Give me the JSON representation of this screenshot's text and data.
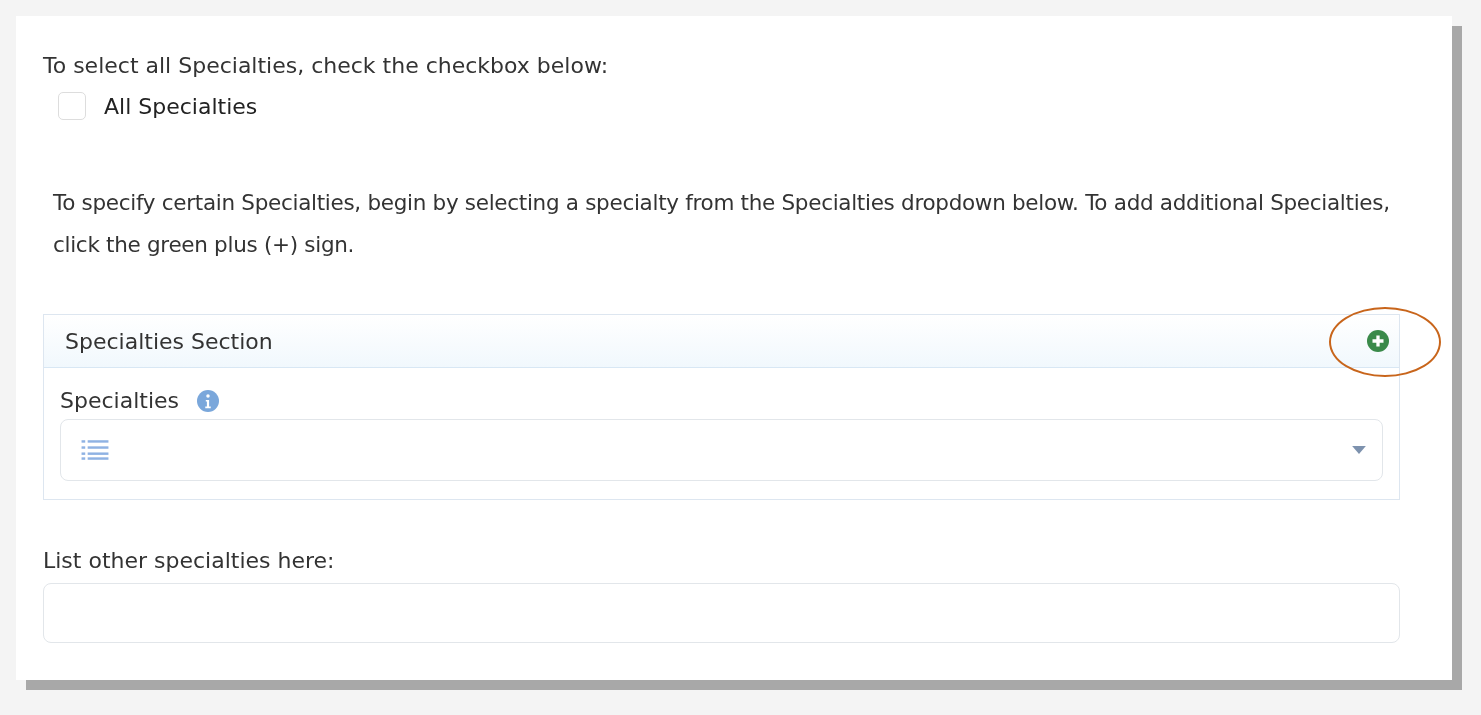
{
  "intro_text": "To select all Specialties, check the checkbox below:",
  "all_checkbox": {
    "label": "All Specialties",
    "checked": false
  },
  "instructions": "To specify certain Specialties, begin by selecting a specialty from the Specialties dropdown below. To add additional Specialties, click the green plus (+) sign.",
  "section": {
    "title": "Specialties Section",
    "add_highlighted": true,
    "field_label": "Specialties"
  },
  "other": {
    "label": "List other specialties here:"
  }
}
